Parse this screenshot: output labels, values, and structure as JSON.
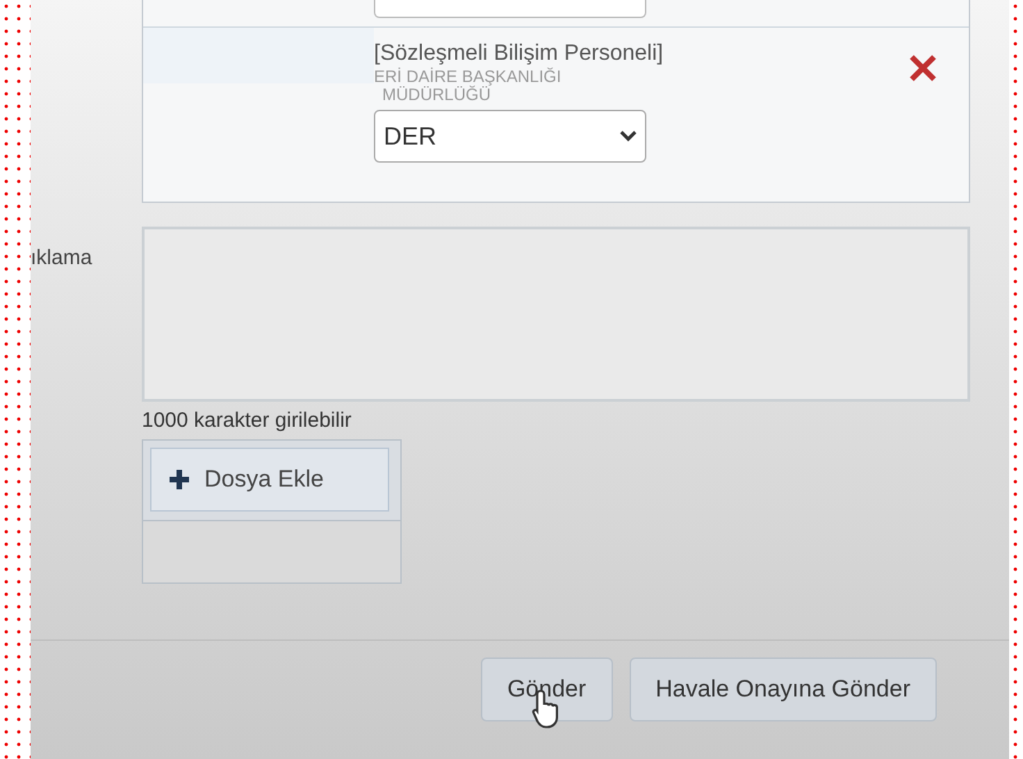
{
  "assignee": {
    "title": "[Sözleşmeli Bilişim Personeli]",
    "unit_line_1": "ERİ DAİRE BAŞKANLIĞI",
    "unit_line_2": "MÜDÜRLÜĞÜ",
    "select_value": "DER"
  },
  "description": {
    "label": "ıklama",
    "hint": "1000 karakter girilebilir"
  },
  "attach_button": "Dosya Ekle",
  "buttons": [
    "Gönder",
    "Havale Onayına Gönder"
  ]
}
